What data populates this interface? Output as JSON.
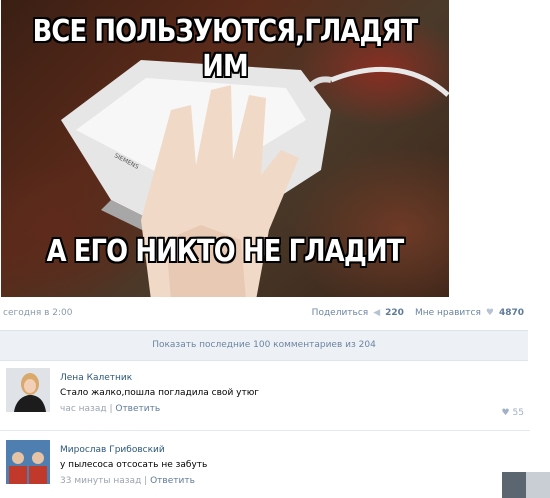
{
  "post": {
    "meme_top": "ВСЕ ПОЛЬЗУЮТСЯ,ГЛАДЯТ ИМ",
    "meme_bottom": "А ЕГО НИКТО НЕ ГЛАДИТ",
    "iron_brand": "SIEMENS",
    "date": "сегодня в 2:00",
    "share_label": "Поделиться",
    "share_count": "220",
    "like_label": "Мне нравится",
    "like_count": "4870"
  },
  "show_comments": "Показать последние 100 комментариев из 204",
  "comments": [
    {
      "author": "Лена Калетник",
      "text": "Стало жалко,пошла погладила свой утюг",
      "time": "час назад",
      "reply": "Ответить",
      "likes": "55"
    },
    {
      "author": "Мирослав Грибовский",
      "text": "у пылесоса отсосать не забуть",
      "time": "33 минуты назад",
      "reply": "Ответить"
    }
  ],
  "icons": {
    "share": "megaphone-icon",
    "like": "heart-icon"
  }
}
